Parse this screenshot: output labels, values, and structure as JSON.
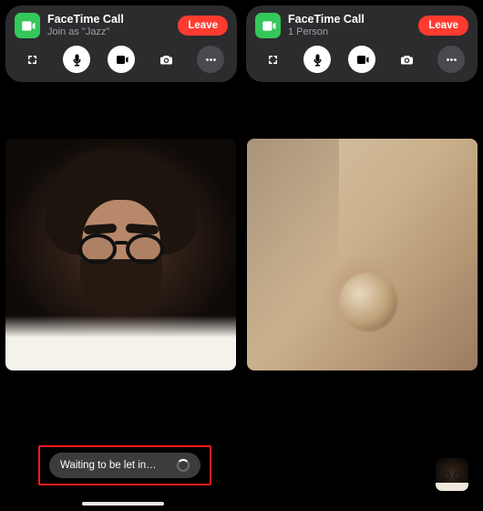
{
  "panels": [
    {
      "title": "FaceTime Call",
      "subtitle": "Join as \"Jazz\"",
      "leave_label": "Leave"
    },
    {
      "title": "FaceTime Call",
      "subtitle": "1 Person",
      "leave_label": "Leave"
    }
  ],
  "waiting": {
    "text": "Waiting to be let in…"
  },
  "icons": {
    "expand": "expand-icon",
    "mic": "mic-icon",
    "video": "video-icon",
    "camera": "camera-icon",
    "more": "more-icon",
    "app": "facetime-app-icon"
  },
  "colors": {
    "green": "#34c759",
    "red": "#ff3b30",
    "panel": "#2c2c2e",
    "highlight_border": "#ff1a1a"
  }
}
